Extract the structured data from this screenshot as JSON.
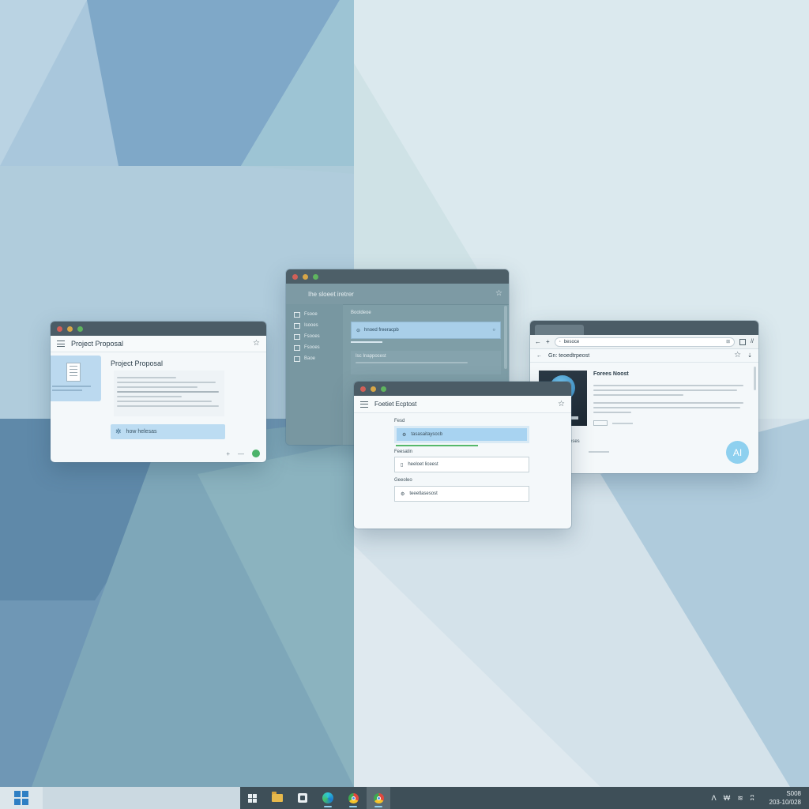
{
  "window_project": {
    "title": "Project Proposal",
    "body_title": "Project Proposal",
    "pill_label": "how helesas"
  },
  "window_settings": {
    "title": "Ihe sloeet iretrer",
    "sidebar": [
      "Fsooe",
      "Isooes",
      "Fsooes",
      "Fsooes",
      "Baoe"
    ],
    "section_label": "Bootdeoe",
    "search_value": "hnoed freeracpb",
    "card_label": "Isc Inappocest"
  },
  "window_browser": {
    "url": "besoce",
    "page_title": "Gn: teoedtrpeost",
    "article_title": "Forees Noost",
    "aside_label": "eses",
    "ai_badge": "AI"
  },
  "window_form": {
    "title": "Foetiet Ecptost",
    "fields": [
      {
        "label": "Fesd",
        "value": "tasasaitaysocb"
      },
      {
        "label": "Feesatin",
        "value": "heeloet liceest"
      },
      {
        "label": "Geeoleo",
        "value": "teeetlasesost"
      }
    ]
  },
  "taskbar": {
    "time": "S008",
    "date": "203-10/028",
    "tray_labels": [
      "ᐱ",
      "₩",
      "≋",
      "ʭ"
    ]
  }
}
